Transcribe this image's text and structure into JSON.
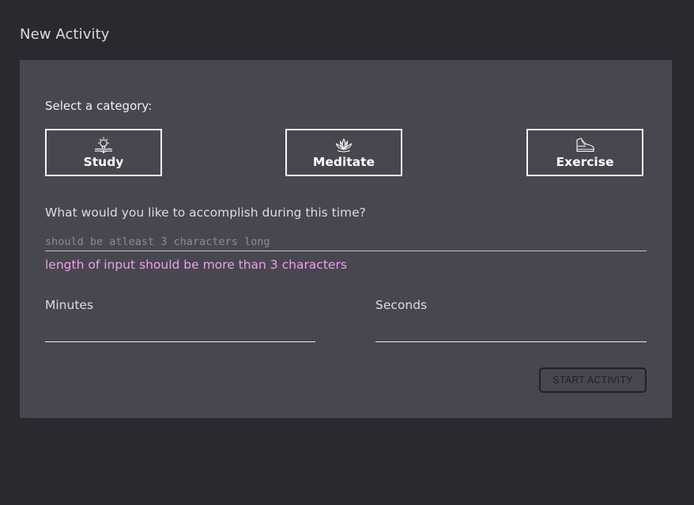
{
  "page": {
    "title": "New Activity"
  },
  "form": {
    "category_label": "Select a category:",
    "categories": [
      {
        "label": "Study",
        "icon": "lightbulb-book-icon"
      },
      {
        "label": "Meditate",
        "icon": "lotus-icon"
      },
      {
        "label": "Exercise",
        "icon": "sneaker-icon"
      }
    ],
    "goal_question": "What would you like to accomplish during this time?",
    "goal_placeholder": "should be atleast 3 characters long",
    "goal_value": "",
    "goal_error": "length of input should be more than 3 characters",
    "minutes_label": "Minutes",
    "minutes_value": "",
    "seconds_label": "Seconds",
    "seconds_value": "",
    "start_label": "START ACTIVITY",
    "start_disabled": true
  },
  "colors": {
    "background": "#2b2930",
    "card": "#48464e",
    "error": "#ef9fef",
    "text": "#dedce2"
  }
}
